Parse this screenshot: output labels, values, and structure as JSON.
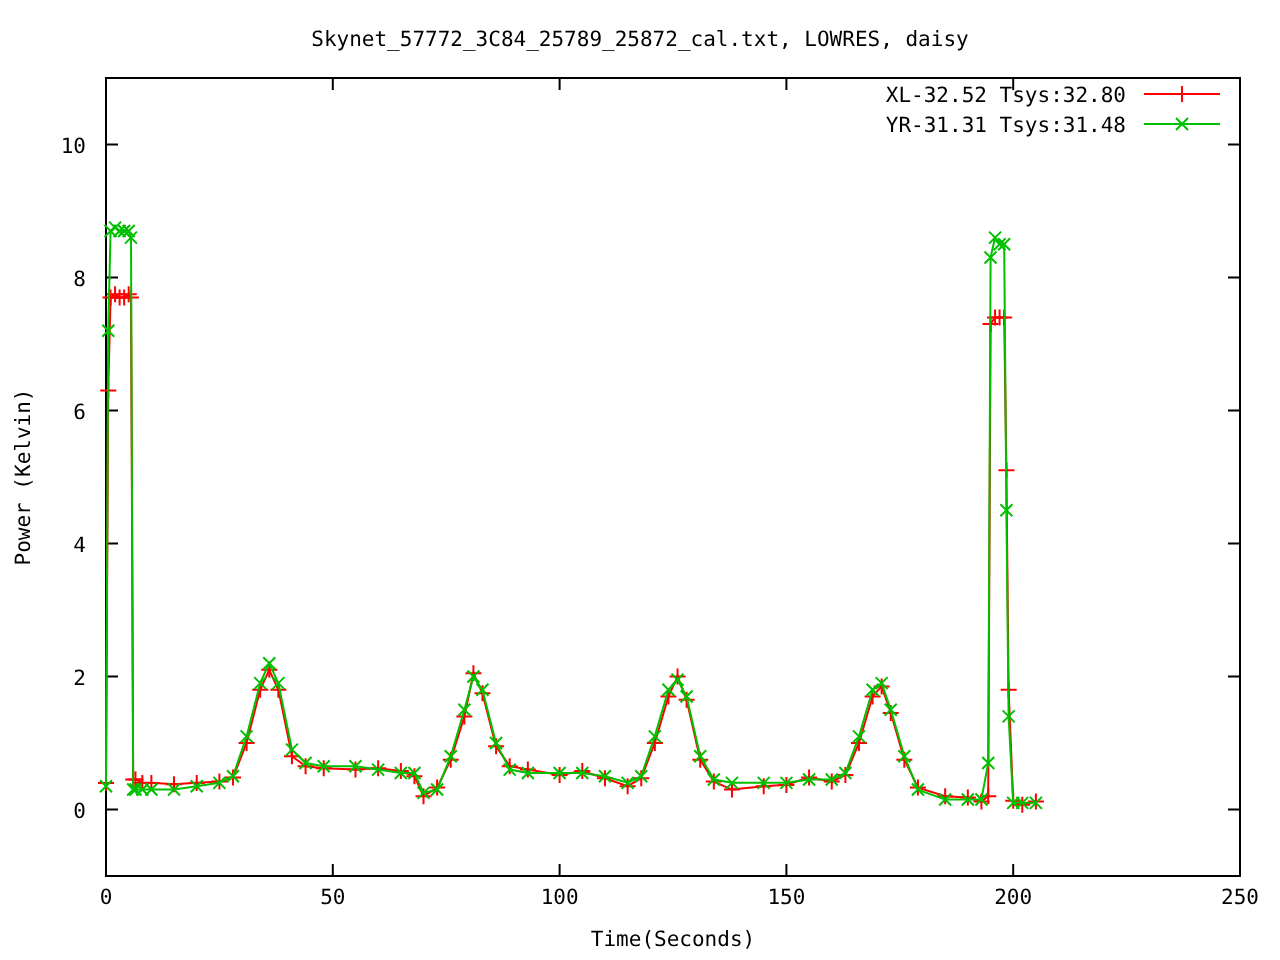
{
  "chart": {
    "chart_data": {
      "type": "line",
      "title": "Skynet_57772_3C84_25789_25872_cal.txt, LOWRES, daisy",
      "xlabel": "Time(Seconds)",
      "ylabel": "Power (Kelvin)",
      "xlim": [
        0,
        250
      ],
      "ylim": [
        -1,
        11
      ],
      "xticks": [
        0,
        50,
        100,
        150,
        200,
        250
      ],
      "yticks": [
        0,
        2,
        4,
        6,
        8,
        10
      ],
      "legend": "top right",
      "x": [
        0,
        0.5,
        1,
        2,
        3,
        4,
        5,
        5.5,
        6,
        6.5,
        8,
        10,
        15,
        20,
        25,
        28,
        31,
        34,
        36,
        38,
        41,
        44,
        48,
        55,
        60,
        65,
        68,
        70,
        73,
        76,
        79,
        81,
        83,
        86,
        89,
        93,
        100,
        105,
        110,
        115,
        118,
        121,
        124,
        126,
        128,
        131,
        134,
        138,
        145,
        150,
        155,
        160,
        163,
        166,
        169,
        171,
        173,
        176,
        179,
        185,
        190,
        193,
        194.5,
        195,
        196,
        197,
        198,
        198.5,
        199,
        200,
        202,
        205
      ],
      "series": [
        {
          "name": "XL-32.52 Tsys:32.80",
          "color": "#ff0000",
          "marker": "plus",
          "values": [
            0.4,
            6.3,
            7.7,
            7.75,
            7.7,
            7.7,
            7.75,
            7.7,
            0.45,
            0.45,
            0.4,
            0.4,
            0.38,
            0.4,
            0.42,
            0.48,
            1.0,
            1.8,
            2.1,
            1.8,
            0.8,
            0.65,
            0.62,
            0.6,
            0.62,
            0.58,
            0.5,
            0.2,
            0.33,
            0.75,
            1.4,
            2.05,
            1.75,
            0.95,
            0.65,
            0.6,
            0.52,
            0.58,
            0.47,
            0.35,
            0.47,
            1.0,
            1.7,
            2.0,
            1.65,
            0.75,
            0.42,
            0.3,
            0.35,
            0.37,
            0.48,
            0.42,
            0.52,
            1.0,
            1.7,
            1.85,
            1.45,
            0.75,
            0.33,
            0.2,
            0.18,
            0.12,
            0.2,
            7.3,
            7.4,
            7.4,
            7.4,
            5.1,
            1.8,
            0.13,
            0.07,
            0.12
          ]
        },
        {
          "name": "YR-31.31 Tsys:31.48",
          "color": "#00c000",
          "marker": "cross",
          "values": [
            0.35,
            7.2,
            8.7,
            8.75,
            8.7,
            8.7,
            8.7,
            8.6,
            0.3,
            0.3,
            0.3,
            0.3,
            0.3,
            0.35,
            0.4,
            0.5,
            1.1,
            1.9,
            2.2,
            1.9,
            0.9,
            0.7,
            0.65,
            0.65,
            0.6,
            0.55,
            0.55,
            0.25,
            0.3,
            0.8,
            1.5,
            2.0,
            1.8,
            1.0,
            0.6,
            0.55,
            0.55,
            0.55,
            0.5,
            0.4,
            0.5,
            1.1,
            1.8,
            1.95,
            1.7,
            0.8,
            0.45,
            0.4,
            0.4,
            0.4,
            0.45,
            0.45,
            0.55,
            1.1,
            1.8,
            1.9,
            1.5,
            0.8,
            0.3,
            0.15,
            0.15,
            0.15,
            0.7,
            8.3,
            8.6,
            8.5,
            8.5,
            4.5,
            1.4,
            0.1,
            0.1,
            0.1
          ]
        }
      ]
    }
  }
}
